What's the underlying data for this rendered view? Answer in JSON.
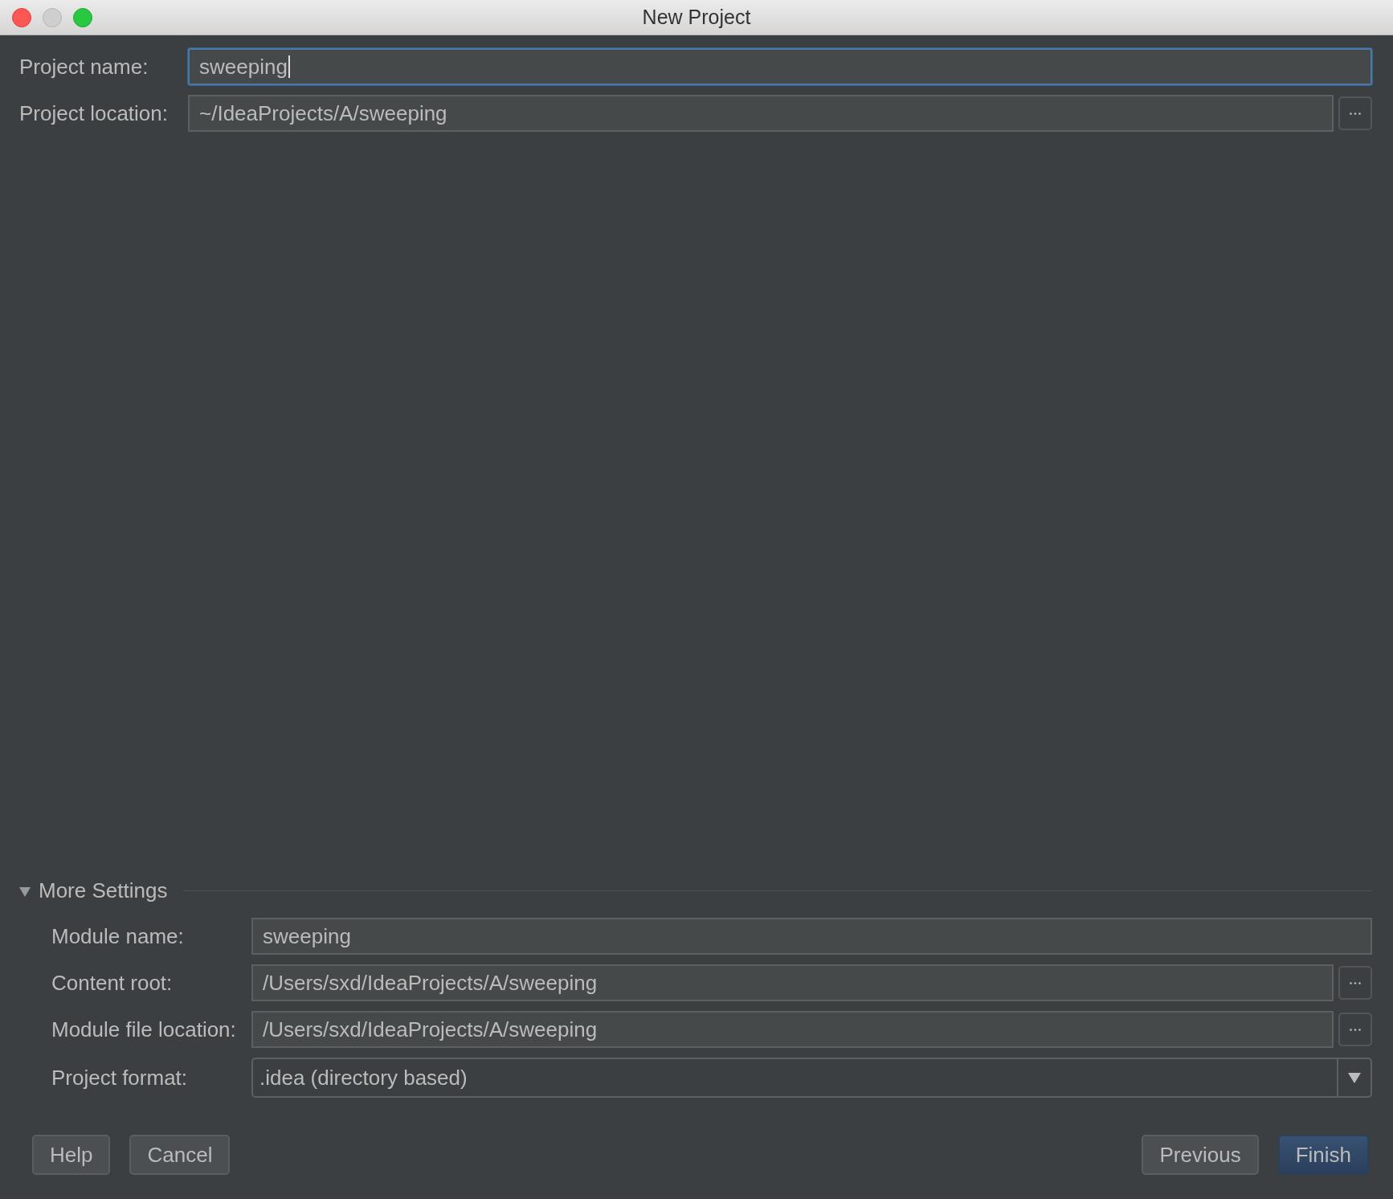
{
  "window": {
    "title": "New Project"
  },
  "fields": [
    {
      "kind": "text",
      "label": "Project name:",
      "value": "sweeping",
      "focused": true,
      "browse": false
    },
    {
      "kind": "text",
      "label": "Project location:",
      "value": "~/IdeaProjects/A/sweeping",
      "focused": false,
      "browse": true
    }
  ],
  "more_settings": {
    "title": "More Settings",
    "expanded": true,
    "fields": [
      {
        "kind": "text",
        "label": "Module name:",
        "value": "sweeping",
        "browse": false
      },
      {
        "kind": "text",
        "label": "Content root:",
        "value": "/Users/sxd/IdeaProjects/A/sweeping",
        "browse": true
      },
      {
        "kind": "text",
        "label": "Module file location:",
        "value": "/Users/sxd/IdeaProjects/A/sweeping",
        "browse": true
      },
      {
        "kind": "select",
        "label": "Project format:",
        "value": ".idea (directory based)",
        "browse": false
      }
    ]
  },
  "buttons_left": [
    {
      "label": "Help",
      "default": false
    },
    {
      "label": "Cancel",
      "default": false
    }
  ],
  "buttons_right": [
    {
      "label": "Previous",
      "default": false
    },
    {
      "label": "Finish",
      "default": true
    }
  ]
}
